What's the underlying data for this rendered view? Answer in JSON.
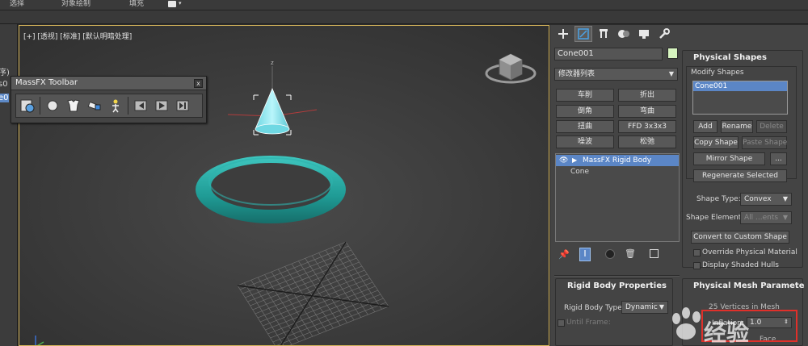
{
  "menubar": {
    "items": [
      "选择",
      "对象绘制",
      "填充"
    ]
  },
  "left_panel": {
    "fragments": [
      "序)",
      "s0",
      "e0"
    ]
  },
  "viewport": {
    "label": "[+] [透视] [标准] [默认明暗处理]",
    "axis_label": "z",
    "colors": {
      "torus": "#2aa5a0",
      "cone": "#8fe8f0",
      "grid": "#8a8a8a",
      "border": "#d6b55a"
    }
  },
  "massfx_toolbar": {
    "title": "MassFX Toolbar",
    "close": "x",
    "tools": [
      "world-settings-icon",
      "rigid-body-icon",
      "mcloth-icon",
      "constraint-icon",
      "ragdoll-icon",
      "reset-simulation-icon",
      "start-simulation-icon",
      "step-simulation-icon"
    ]
  },
  "command_panel": {
    "tabs": [
      "create-tab-icon",
      "modify-tab-icon",
      "hierarchy-tab-icon",
      "motion-tab-icon",
      "display-tab-icon",
      "utilities-tab-icon"
    ],
    "object_name": "Cone001",
    "object_color": "#d7f5c0",
    "modifier_list": "修改器列表",
    "modifier_buttons": [
      [
        "车削",
        "折出"
      ],
      [
        "倒角",
        "弯曲"
      ],
      [
        "扭曲",
        "FFD 3x3x3"
      ],
      [
        "噪波",
        "松弛"
      ]
    ],
    "stack": {
      "items": [
        "MassFX Rigid Body",
        "Cone"
      ]
    },
    "stack_tools": [
      "pin-stack-icon",
      "show-end-result-icon",
      "make-unique-icon",
      "remove-modifier-icon",
      "configure-modifier-sets-icon"
    ],
    "physical_shapes": {
      "title": "Physical Shapes",
      "modify_shapes": "Modify Shapes",
      "list": [
        "Cone001"
      ],
      "buttons": {
        "add": "Add",
        "rename": "Rename",
        "delete": "Delete",
        "copy": "Copy Shape",
        "paste": "Paste Shape",
        "mirror": "Mirror Shape",
        "more": "...",
        "regenerate": "Regenerate Selected"
      },
      "shape_type_label": "Shape Type:",
      "shape_type_value": "Convex",
      "shape_element_label": "Shape Element:",
      "shape_element_value": "All ...ents",
      "convert": "Convert to Custom Shape",
      "override_material": "Override Physical Material",
      "display_hulls": "Display Shaded Hulls"
    },
    "rigid_body": {
      "title": "Rigid Body Properties",
      "type_label": "Rigid Body Type:",
      "type_value": "Dynamic",
      "until_frame": "Until Frame:"
    },
    "physical_mesh": {
      "title": "Physical Mesh Paramete",
      "vertices": "25 Vertices in Mesh",
      "inflation_label": "Inflation:",
      "inflation_value": "1.0",
      "from_surface": "Face"
    }
  },
  "watermark": {
    "text": "经验"
  }
}
